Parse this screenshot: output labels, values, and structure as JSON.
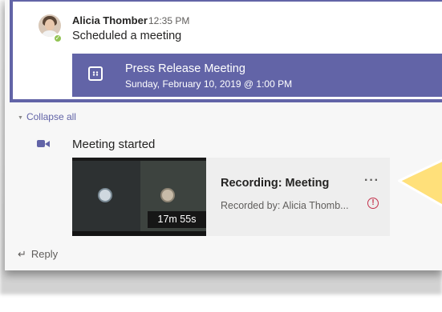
{
  "post": {
    "author": "Alicia Thomber",
    "time": "12:35 PM",
    "message": "Scheduled a meeting"
  },
  "meeting_banner": {
    "title": "Press Release Meeting",
    "datetime": "Sunday, February 10, 2019 @ 1:00 PM",
    "icon": "calendar-icon",
    "color": "#6264a7"
  },
  "collapse_all": "Collapse all",
  "activity": {
    "label": "Meeting started",
    "icon": "video-camera-icon"
  },
  "recording": {
    "duration": "17m 55s",
    "title": "Recording: Meeting",
    "recorded_by": "Recorded by: Alicia Thomb...",
    "more": "···",
    "warning_glyph": "!"
  },
  "reply": {
    "arrow": "↵",
    "label": "Reply"
  },
  "colors": {
    "accent": "#6264a7",
    "callout_fill": "#ffe07a",
    "warning": "#c4314b",
    "presence": "#92c353"
  }
}
